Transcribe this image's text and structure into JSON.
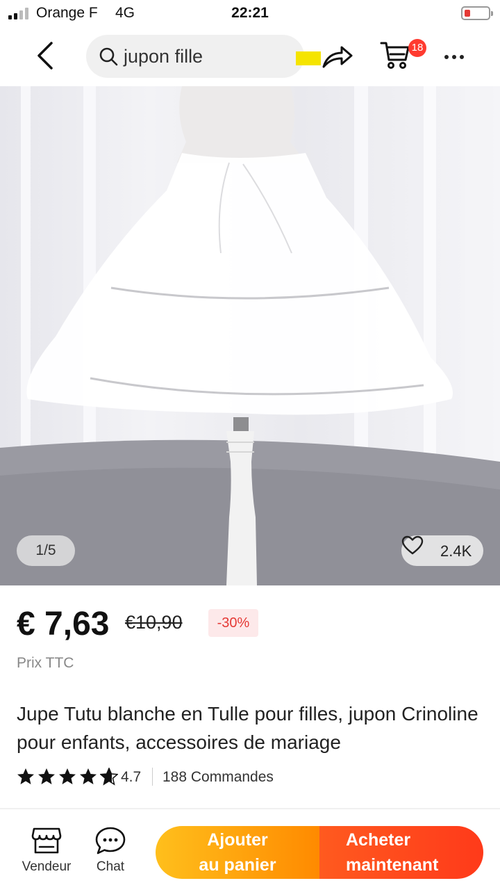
{
  "status_bar": {
    "carrier": "Orange F",
    "network": "4G",
    "time": "22:21"
  },
  "nav": {
    "search_query": "jupon fille",
    "cart_count": "18"
  },
  "gallery": {
    "counter": "1/5",
    "likes": "2.4K"
  },
  "product": {
    "price": "€ 7,63",
    "original_price": "€10,90",
    "discount": "-30%",
    "tax_note": "Prix TTC",
    "title": "Jupe Tutu blanche en Tulle pour filles, jupon Crinoline pour enfants, accessoires de mariage",
    "rating": "4.7",
    "orders": "188 Commandes"
  },
  "bottom_bar": {
    "vendor_label": "Vendeur",
    "chat_label": "Chat",
    "add_to_cart": "Ajouter\nau panier",
    "buy_now": "Acheter\nmaintenant"
  },
  "colors": {
    "accent_red": "#ff3b30",
    "discount_red": "#e53935",
    "cta_orange": "#ff8a00",
    "cta_red": "#ff3a1a"
  }
}
